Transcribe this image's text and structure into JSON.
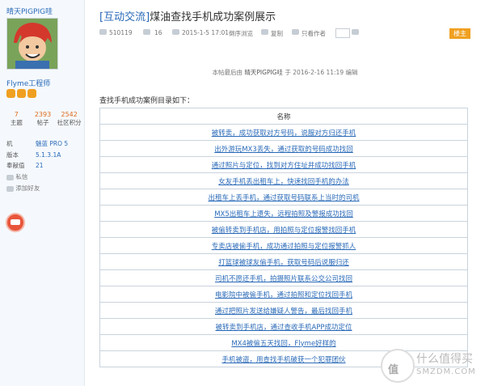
{
  "author": {
    "username": "晴天PIGPIG哇",
    "rank": "Flyme工程师",
    "badges": [
      "",
      "",
      ""
    ],
    "stats": [
      {
        "value": "7",
        "label": "主题"
      },
      {
        "value": "2393",
        "label": "帖子"
      },
      {
        "value": "2542",
        "label": "社区积分"
      }
    ],
    "info": [
      {
        "key": "机",
        "value": "魅蓝 PRO 5"
      },
      {
        "key": "版本",
        "value": "5.1.3.1A"
      },
      {
        "key": "奉献值",
        "value": "21"
      }
    ],
    "actions": [
      "私信",
      "添加好友"
    ]
  },
  "post": {
    "category": "[互动交流]",
    "title": "煤油查找手机成功案例展示",
    "views": "510119",
    "replies": "16",
    "date": "2015-1-5 17:01",
    "view_mode": "倒序浏览",
    "copy": "复制",
    "author_only": "只看作者",
    "owner_tag": "楼主",
    "edit_note_prefix": "本帖最后由",
    "edit_note_name": "晴天PIGPIG哇",
    "edit_note_suffix": "于 2016-2-16 11:19 编辑",
    "intro": "查找手机成功案例目录如下："
  },
  "table": {
    "header": "名称",
    "rows": [
      "被转卖，成功获取对方号码，说服对方归还手机",
      "出外游玩MX3丢失，通过获取的号码成功找回",
      "通过照片与定位，找到对方住址并成功找回手机",
      "女友手机丢出租车上，快速找回手机的办法",
      "出租车上丢手机，通过获取号码联系上当时的司机",
      "MX5出租车上遗失，远程拍照及警报成功找回",
      "被偷转卖到手机店，用拍照与定位报警找回手机",
      "专卖店被偷手机，成功通过拍照与定位报警抓人",
      "打篮球被球友偷手机，获取号码后说服归还",
      "司机不愿还手机，拍摄照片联系公交公司找回",
      "电影院中被偷手机，通过拍照和定位找回手机",
      "通过把照片发送给嫌疑人警告，最后找回手机",
      "被转卖到手机店，通过查收手机APP成功定位",
      "MX4被偷五天找回，Flyme好样的",
      "手机被盗，用查找手机破获一个犯罪团伙"
    ]
  },
  "watermark": {
    "logo_letter": "值",
    "line1": "什么值得买",
    "line2": "SMZDM.COM"
  }
}
